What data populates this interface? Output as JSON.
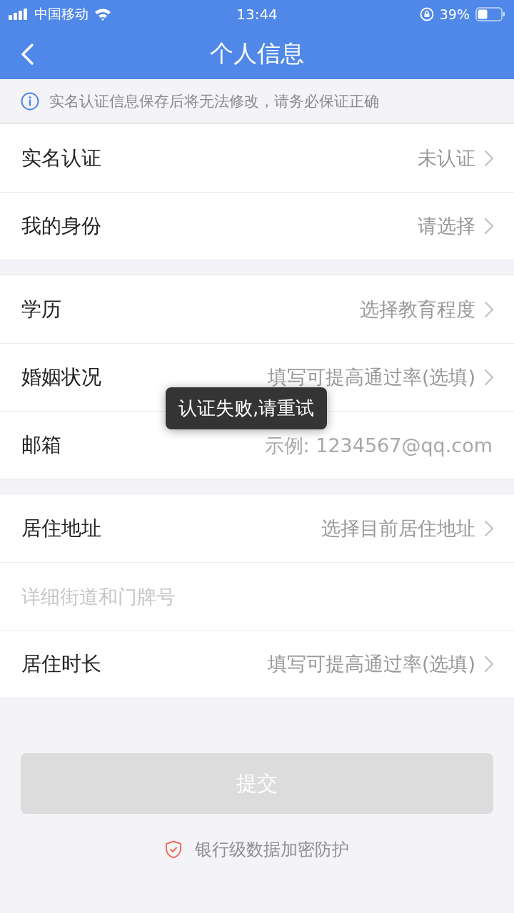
{
  "status_bar": {
    "carrier": "中国移动",
    "time": "13:44",
    "battery": "39%"
  },
  "nav": {
    "title": "个人信息"
  },
  "notice": "实名认证信息保存后将无法修改，请务必保证正确",
  "groups": [
    {
      "rows": [
        {
          "kind": "select",
          "label": "实名认证",
          "value": "未认证"
        },
        {
          "kind": "select",
          "label": "我的身份",
          "value": "请选择"
        }
      ]
    },
    {
      "rows": [
        {
          "kind": "select",
          "label": "学历",
          "value": "选择教育程度"
        },
        {
          "kind": "select",
          "label": "婚姻状况",
          "value": "填写可提高通过率(选填)"
        },
        {
          "kind": "input",
          "label": "邮箱",
          "placeholder": "示例: 1234567@qq.com"
        }
      ]
    },
    {
      "rows": [
        {
          "kind": "select",
          "label": "居住地址",
          "value": "选择目前居住地址"
        },
        {
          "kind": "field",
          "placeholder": "详细街道和门牌号"
        },
        {
          "kind": "select",
          "label": "居住时长",
          "value": "填写可提高通过率(选填)"
        }
      ]
    }
  ],
  "submit": {
    "label": "提交",
    "disabled": true
  },
  "security_note": "银行级数据加密防护",
  "toast": "认证失败,请重试"
}
